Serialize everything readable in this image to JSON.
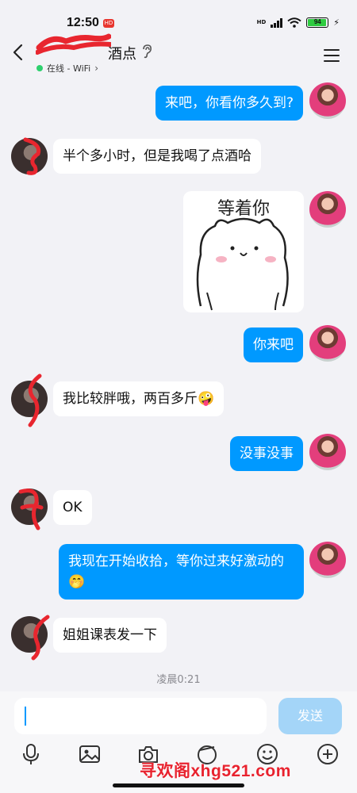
{
  "status_bar": {
    "time": "12:50",
    "badge": "HD",
    "network_label": "HD",
    "battery": "94",
    "battery_level": 0.94
  },
  "header": {
    "title_visible": "酒点",
    "online_status": "在线 - WiFi",
    "online_color": "#2ed06e"
  },
  "messages": [
    {
      "side": "out",
      "type": "text",
      "text": "来吧，你看你多久到?"
    },
    {
      "side": "in",
      "type": "text",
      "text": "半个多小时，但是我喝了点酒哈"
    },
    {
      "side": "out",
      "type": "sticker",
      "text": "等着你"
    },
    {
      "side": "out",
      "type": "text",
      "text": "你来吧"
    },
    {
      "side": "in",
      "type": "text",
      "text": "我比较胖哦，两百多斤🤪"
    },
    {
      "side": "out",
      "type": "text",
      "text": "没事没事"
    },
    {
      "side": "in",
      "type": "text",
      "text": "OK"
    },
    {
      "side": "out",
      "type": "text",
      "text": "我现在开始收拾，等你过来好激动的🤭"
    },
    {
      "side": "in",
      "type": "text",
      "text": "姐姐课表发一下"
    }
  ],
  "timestamp": "凌晨0:21",
  "input": {
    "value": "",
    "send_label": "发送"
  },
  "toolbar_icons": [
    "microphone-icon",
    "image-icon",
    "camera-icon",
    "emoji-face-icon",
    "smile-icon",
    "plus-icon"
  ],
  "watermark": "寻欢阁xhg521.com",
  "colors": {
    "outgoing_bubble": "#0099ff",
    "incoming_bubble": "#ffffff",
    "background": "#f2f2f6",
    "send_button": "#a4d5f8"
  }
}
